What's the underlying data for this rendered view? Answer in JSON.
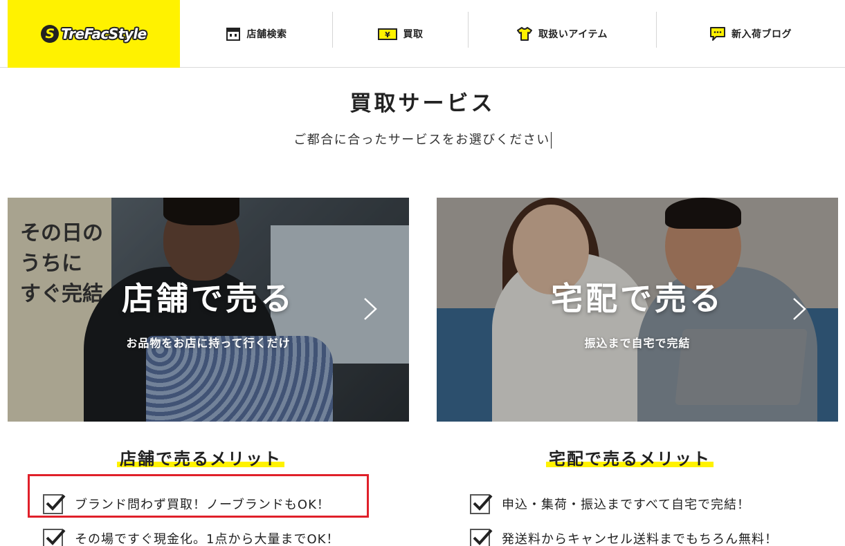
{
  "header": {
    "logo_mark": "S",
    "logo_text": "TreFacStyle",
    "nav": [
      {
        "label": "店舗検索",
        "icon": "store-icon"
      },
      {
        "label": "買取",
        "icon": "yen-icon"
      },
      {
        "label": "取扱いアイテム",
        "icon": "tshirt-icon"
      },
      {
        "label": "新入荷ブログ",
        "icon": "chat-bubble-icon"
      }
    ]
  },
  "main": {
    "title": "買取サービス",
    "subtitle": "ご都合に合ったサービスをお選びください"
  },
  "cards": [
    {
      "title": "店舗で売る",
      "subtitle": "お品物をお店に持って行くだけ",
      "photo_sign": "その日のうちにすぐ完結"
    },
    {
      "title": "宅配で売る",
      "subtitle": "振込まで自宅で完結"
    }
  ],
  "merits": [
    {
      "title": "店舗で売るメリット",
      "items": [
        "ブランド問わず買取！ノーブランドもOK！",
        "その場ですぐ現金化。1点から大量までOK！"
      ]
    },
    {
      "title": "宅配で売るメリット",
      "items": [
        "申込・集荷・振込まですべて自宅で完結！",
        "発送料からキャンセル送料までもちろん無料！"
      ]
    }
  ],
  "colors": {
    "brand_yellow": "#fff200",
    "highlight_red": "#e0202a",
    "text": "#222222"
  }
}
